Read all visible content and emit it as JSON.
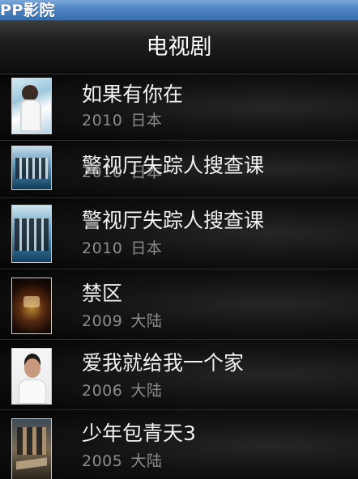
{
  "app": {
    "title": "PP影院"
  },
  "header": {
    "title": "电视剧"
  },
  "list": [
    {
      "name": "如果有你在",
      "year": "2010",
      "region": "日本"
    },
    {
      "name": "警视厅失踪人搜查课",
      "year": "2010",
      "region": "日本"
    },
    {
      "name": "警视厅失踪人搜查课",
      "year": "2010",
      "region": "日本"
    },
    {
      "name": "禁区",
      "year": "2009",
      "region": "大陆"
    },
    {
      "name": "爱我就给我一个家",
      "year": "2006",
      "region": "大陆"
    },
    {
      "name": "少年包青天3",
      "year": "2005",
      "region": "大陆"
    }
  ],
  "colors": {
    "titlebar": "#4f84c1",
    "background": "#050505",
    "title_text": "#ffffff",
    "meta_text": "#8c8c8c"
  }
}
